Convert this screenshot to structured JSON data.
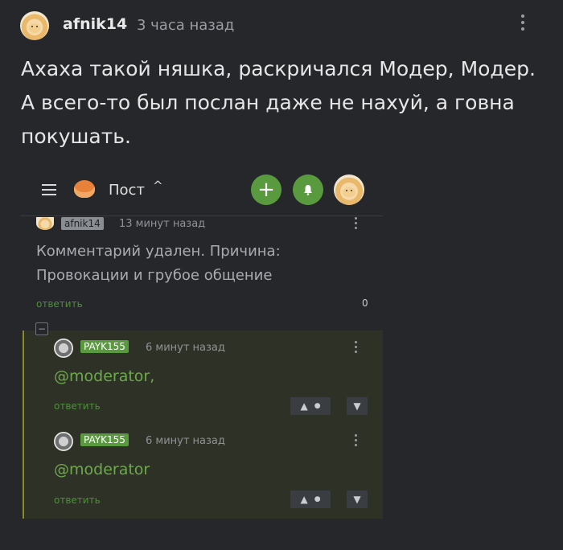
{
  "comment": {
    "user": "afnik14",
    "time": "3 часа назад",
    "text": "Ахаха такой няшка, раскричался Модер, Модер. А всего-то был послан даже не нахуй, а говна покушать."
  },
  "screenshot": {
    "nav": {
      "post_label": "Пост",
      "chevron": "^",
      "add_symbol": "+"
    },
    "deleted_comment": {
      "user": "afnik14",
      "time": "13 минут назад",
      "text": "Комментарий удален. Причина: Провокации и грубое общение",
      "reply_label": "ответить",
      "count": "0"
    },
    "collapse_symbol": "−",
    "replies": [
      {
        "user": "PAYK155",
        "time": "6 минут назад",
        "text": "@moderator,",
        "reply_label": "ответить",
        "up": "▲",
        "dot": "●",
        "down": "▼"
      },
      {
        "user": "PAYK155",
        "time": "6 минут назад",
        "text": "@moderator",
        "reply_label": "ответить",
        "up": "▲",
        "dot": "●",
        "down": "▼"
      }
    ]
  },
  "colors": {
    "background": "#25272b",
    "accent_green": "#5a9a3e",
    "thread_bg": "#2e3226",
    "thread_line": "#8a8a2a"
  },
  "icons": [
    "avatar",
    "kebab-icon",
    "hamburger-icon",
    "logo-icon",
    "chevron-up-icon",
    "plus-icon",
    "bell-icon",
    "vote-up-icon",
    "vote-down-icon"
  ]
}
